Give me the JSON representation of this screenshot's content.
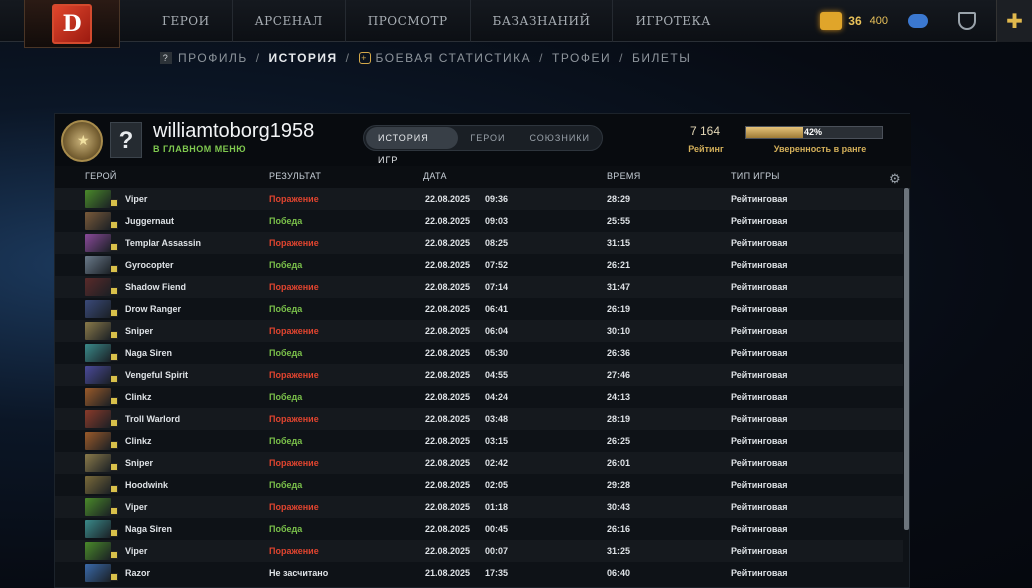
{
  "top_nav": {
    "logo": "D",
    "items": [
      "ГЕРОИ",
      "АРСЕНАЛ",
      "ПРОСМОТР",
      "БАЗАЗНАНИЙ",
      "ИГРОТЕКА"
    ],
    "gold_count": "36",
    "shards": "400"
  },
  "sub_nav": {
    "items": [
      "ПРОФИЛЬ",
      "ИСТОРИЯ",
      "БОЕВАЯ СТАТИСТИКА",
      "ТРОФЕИ",
      "БИЛЕТЫ"
    ],
    "active": "ИСТОРИЯ"
  },
  "profile": {
    "avatar": "?",
    "username": "williamtoborg1958",
    "status": "В ГЛАВНОМ МЕНЮ",
    "tabs": [
      "ИСТОРИЯ ИГР",
      "ГЕРОИ",
      "СОЮЗНИКИ"
    ],
    "mmr": "7 164",
    "mmr_label": "Рейтинг",
    "confidence": "42%",
    "confidence_value": 0.42,
    "confidence_label": "Уверенность в ранге"
  },
  "table": {
    "headers": [
      "ГЕРОЙ",
      "РЕЗУЛЬТАТ",
      "ДАТА",
      "ВРЕМЯ",
      "ТИП ИГРЫ"
    ],
    "rows": [
      {
        "hero": "Viper",
        "result": "Поражение",
        "date": "22.08.2025",
        "time": "09:36",
        "duration": "28:29",
        "type": "Рейтинговая",
        "color": "#4a8a2a"
      },
      {
        "hero": "Juggernaut",
        "result": "Победа",
        "date": "22.08.2025",
        "time": "09:03",
        "duration": "25:55",
        "type": "Рейтинговая",
        "color": "#7a5a3a"
      },
      {
        "hero": "Templar Assassin",
        "result": "Поражение",
        "date": "22.08.2025",
        "time": "08:25",
        "duration": "31:15",
        "type": "Рейтинговая",
        "color": "#8a4a9a"
      },
      {
        "hero": "Gyrocopter",
        "result": "Победа",
        "date": "22.08.2025",
        "time": "07:52",
        "duration": "26:21",
        "type": "Рейтинговая",
        "color": "#6a7a8a"
      },
      {
        "hero": "Shadow Fiend",
        "result": "Поражение",
        "date": "22.08.2025",
        "time": "07:14",
        "duration": "31:47",
        "type": "Рейтинговая",
        "color": "#5a2a2a"
      },
      {
        "hero": "Drow Ranger",
        "result": "Победа",
        "date": "22.08.2025",
        "time": "06:41",
        "duration": "26:19",
        "type": "Рейтинговая",
        "color": "#3a4a7a"
      },
      {
        "hero": "Sniper",
        "result": "Поражение",
        "date": "22.08.2025",
        "time": "06:04",
        "duration": "30:10",
        "type": "Рейтинговая",
        "color": "#8a7a4a"
      },
      {
        "hero": "Naga Siren",
        "result": "Победа",
        "date": "22.08.2025",
        "time": "05:30",
        "duration": "26:36",
        "type": "Рейтинговая",
        "color": "#3a8a8a"
      },
      {
        "hero": "Vengeful Spirit",
        "result": "Поражение",
        "date": "22.08.2025",
        "time": "04:55",
        "duration": "27:46",
        "type": "Рейтинговая",
        "color": "#4a4a9a"
      },
      {
        "hero": "Clinkz",
        "result": "Победа",
        "date": "22.08.2025",
        "time": "04:24",
        "duration": "24:13",
        "type": "Рейтинговая",
        "color": "#9a5a2a"
      },
      {
        "hero": "Troll Warlord",
        "result": "Поражение",
        "date": "22.08.2025",
        "time": "03:48",
        "duration": "28:19",
        "type": "Рейтинговая",
        "color": "#8a3a2a"
      },
      {
        "hero": "Clinkz",
        "result": "Победа",
        "date": "22.08.2025",
        "time": "03:15",
        "duration": "26:25",
        "type": "Рейтинговая",
        "color": "#9a5a2a"
      },
      {
        "hero": "Sniper",
        "result": "Поражение",
        "date": "22.08.2025",
        "time": "02:42",
        "duration": "26:01",
        "type": "Рейтинговая",
        "color": "#8a7a4a"
      },
      {
        "hero": "Hoodwink",
        "result": "Победа",
        "date": "22.08.2025",
        "time": "02:05",
        "duration": "29:28",
        "type": "Рейтинговая",
        "color": "#7a6a3a"
      },
      {
        "hero": "Viper",
        "result": "Поражение",
        "date": "22.08.2025",
        "time": "01:18",
        "duration": "30:43",
        "type": "Рейтинговая",
        "color": "#4a8a2a"
      },
      {
        "hero": "Naga Siren",
        "result": "Победа",
        "date": "22.08.2025",
        "time": "00:45",
        "duration": "26:16",
        "type": "Рейтинговая",
        "color": "#3a8a8a"
      },
      {
        "hero": "Viper",
        "result": "Поражение",
        "date": "22.08.2025",
        "time": "00:07",
        "duration": "31:25",
        "type": "Рейтинговая",
        "color": "#4a8a2a"
      },
      {
        "hero": "Razor",
        "result": "Не засчитано",
        "date": "21.08.2025",
        "time": "17:35",
        "duration": "06:40",
        "type": "Рейтинговая",
        "color": "#3a6aaa"
      }
    ]
  },
  "colors": {
    "loss": "#e0442f",
    "win": "#7ac04a",
    "accent_gold": "#d4b05a",
    "status_green": "#7fc94f"
  }
}
